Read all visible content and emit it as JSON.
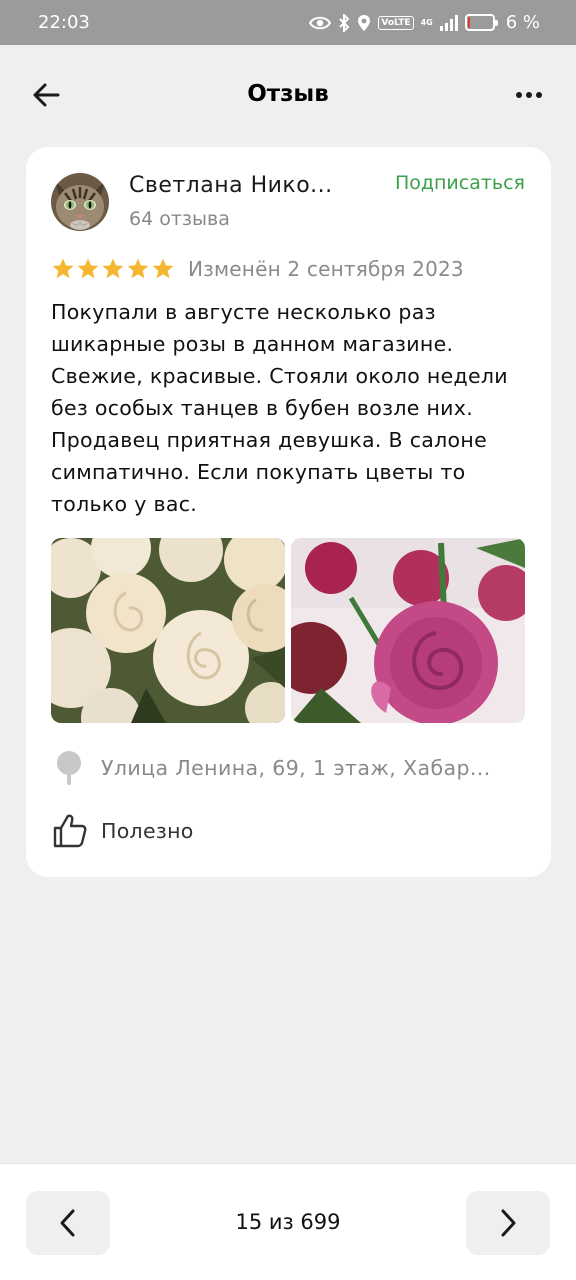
{
  "status_bar": {
    "time": "22:03",
    "volte": "VoLTE",
    "network": "4G",
    "battery_text": "6 %",
    "battery_level": 0.06
  },
  "header": {
    "title": "Отзыв"
  },
  "review": {
    "author_name": "Светлана Нико...",
    "review_count": "64 отзыва",
    "subscribe_label": "Подписаться",
    "rating": 5,
    "rating_max": 5,
    "edited": "Изменён 2 сентября 2023",
    "text": "Покупали в августе несколько раз шикарные розы в данном магазине. Свежие, красивые. Стояли около недели без особых танцев в бубен возле них. Продавец приятная девушка. В салоне симпатично. Если покупать цветы то только у вас.",
    "photos": [
      {
        "icon": "cream-roses-photo"
      },
      {
        "icon": "pink-roses-photo"
      }
    ],
    "address": "Улица Ленина, 69, 1 этаж, Хабар...",
    "helpful_label": "Полезно"
  },
  "pager": {
    "text": "15 из 699"
  },
  "colors": {
    "accent_green": "#3aa04a",
    "star": "#f5b731",
    "background": "#efefef"
  }
}
